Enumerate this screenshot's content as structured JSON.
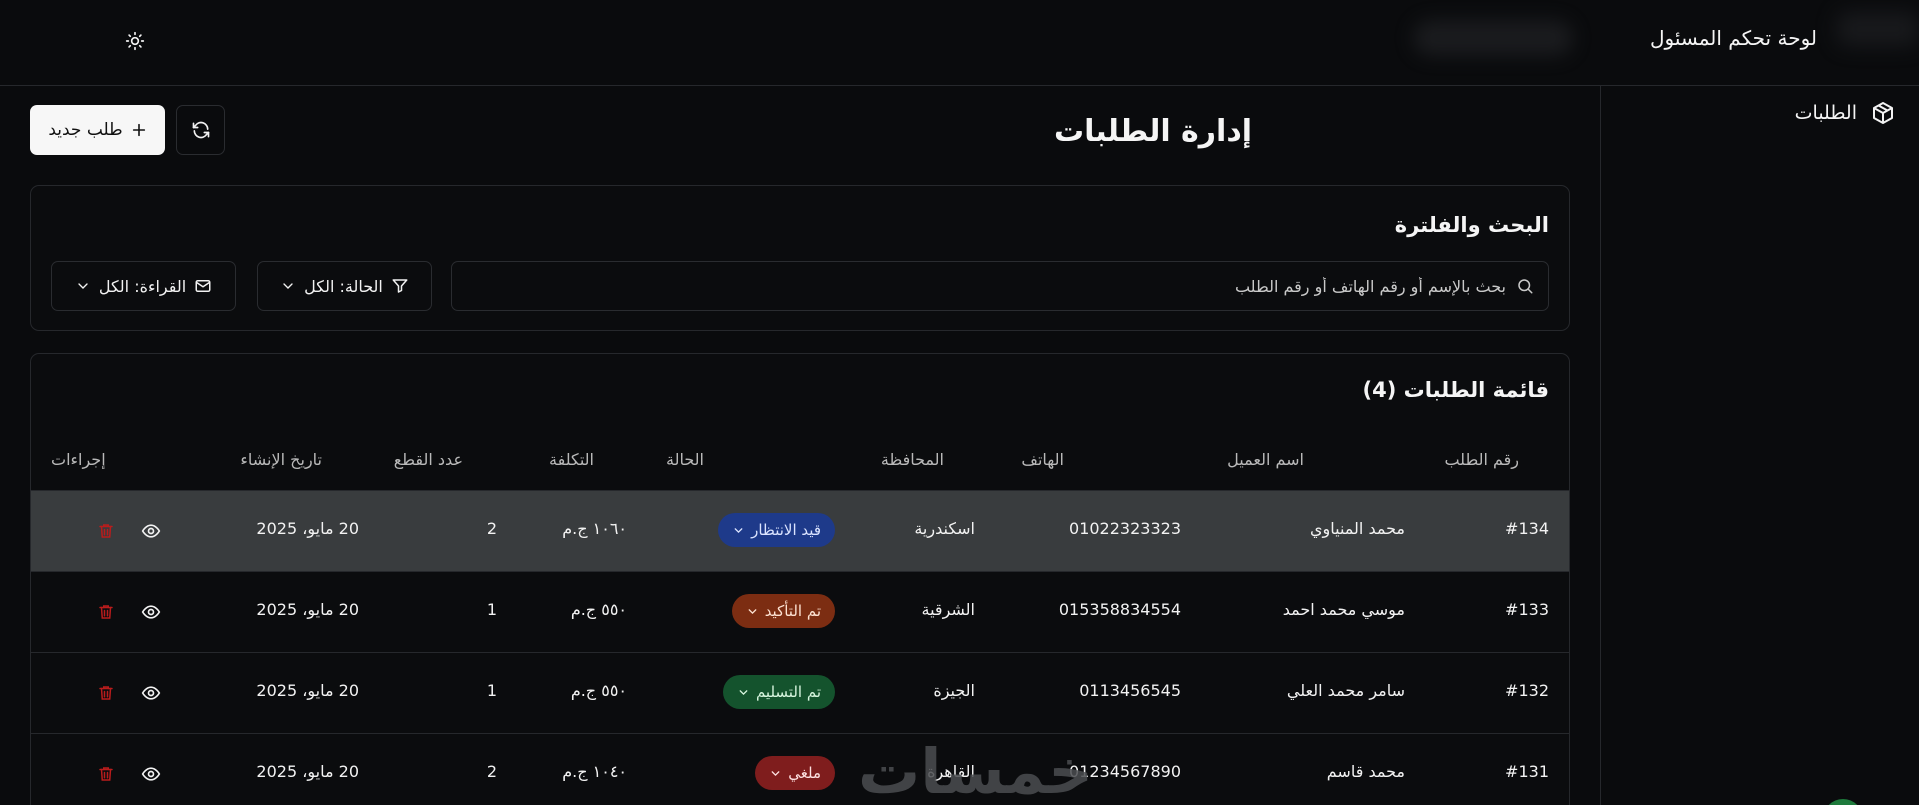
{
  "header": {
    "app_title": "لوحة تحكم المسئول"
  },
  "sidebar": {
    "items": [
      {
        "label": "الطلبات",
        "icon": "box-icon"
      }
    ]
  },
  "page": {
    "title": "إدارة الطلبات",
    "new_button": "طلب جديد"
  },
  "filters": {
    "title": "البحث والفلترة",
    "search_placeholder": "بحث بالإسم أو رقم الهاتف أو رقم الطلب",
    "status_label": "الحالة: الكل",
    "read_label": "القراءة: الكل"
  },
  "orders": {
    "title": "قائمة الطلبات (4)",
    "columns": {
      "id": "رقم الطلب",
      "customer": "اسم العميل",
      "phone": "الهاتف",
      "governorate": "المحافظة",
      "status": "الحالة",
      "cost": "التكلفة",
      "pieces": "عدد القطع",
      "created": "تاريخ الإنشاء",
      "actions": "إجراءات"
    },
    "rows": [
      {
        "id": "#134",
        "customer": "محمد المنياوي",
        "phone": "01022323323",
        "governorate": "اسكندرية",
        "status": "قيد الانتظار",
        "status_color": "#1e3a8a",
        "status_text_color": "#dbe4ff",
        "cost": "١٠٦٠ ج.م",
        "pieces": "2",
        "created": "20 مايو، 2025"
      },
      {
        "id": "#133",
        "customer": "موسي محمد احمد",
        "phone": "015358834554",
        "governorate": "الشرقية",
        "status": "تم التأكيد",
        "status_color": "#7c2d12",
        "status_text_color": "#fde2d2",
        "cost": "٥٥٠ ج.م",
        "pieces": "1",
        "created": "20 مايو، 2025"
      },
      {
        "id": "#132",
        "customer": "سامر محمد العلي",
        "phone": "0113456545",
        "governorate": "الجيزة",
        "status": "تم التسليم",
        "status_color": "#14532d",
        "status_text_color": "#d7f5de",
        "cost": "٥٥٠ ج.م",
        "pieces": "1",
        "created": "20 مايو، 2025"
      },
      {
        "id": "#131",
        "customer": "محمد قاسم",
        "phone": "01234567890",
        "governorate": "القاهرة",
        "status": "ملغي",
        "status_color": "#7f1d1d",
        "status_text_color": "#fde0e0",
        "cost": "١٠٤٠ ج.م",
        "pieces": "2",
        "created": "20 مايو، 2025"
      }
    ]
  },
  "watermark": "خمسات",
  "colors": {
    "background": "#0a0b0d",
    "border": "#26282c",
    "active_row": "#393c3e",
    "danger": "#b91c1c"
  }
}
